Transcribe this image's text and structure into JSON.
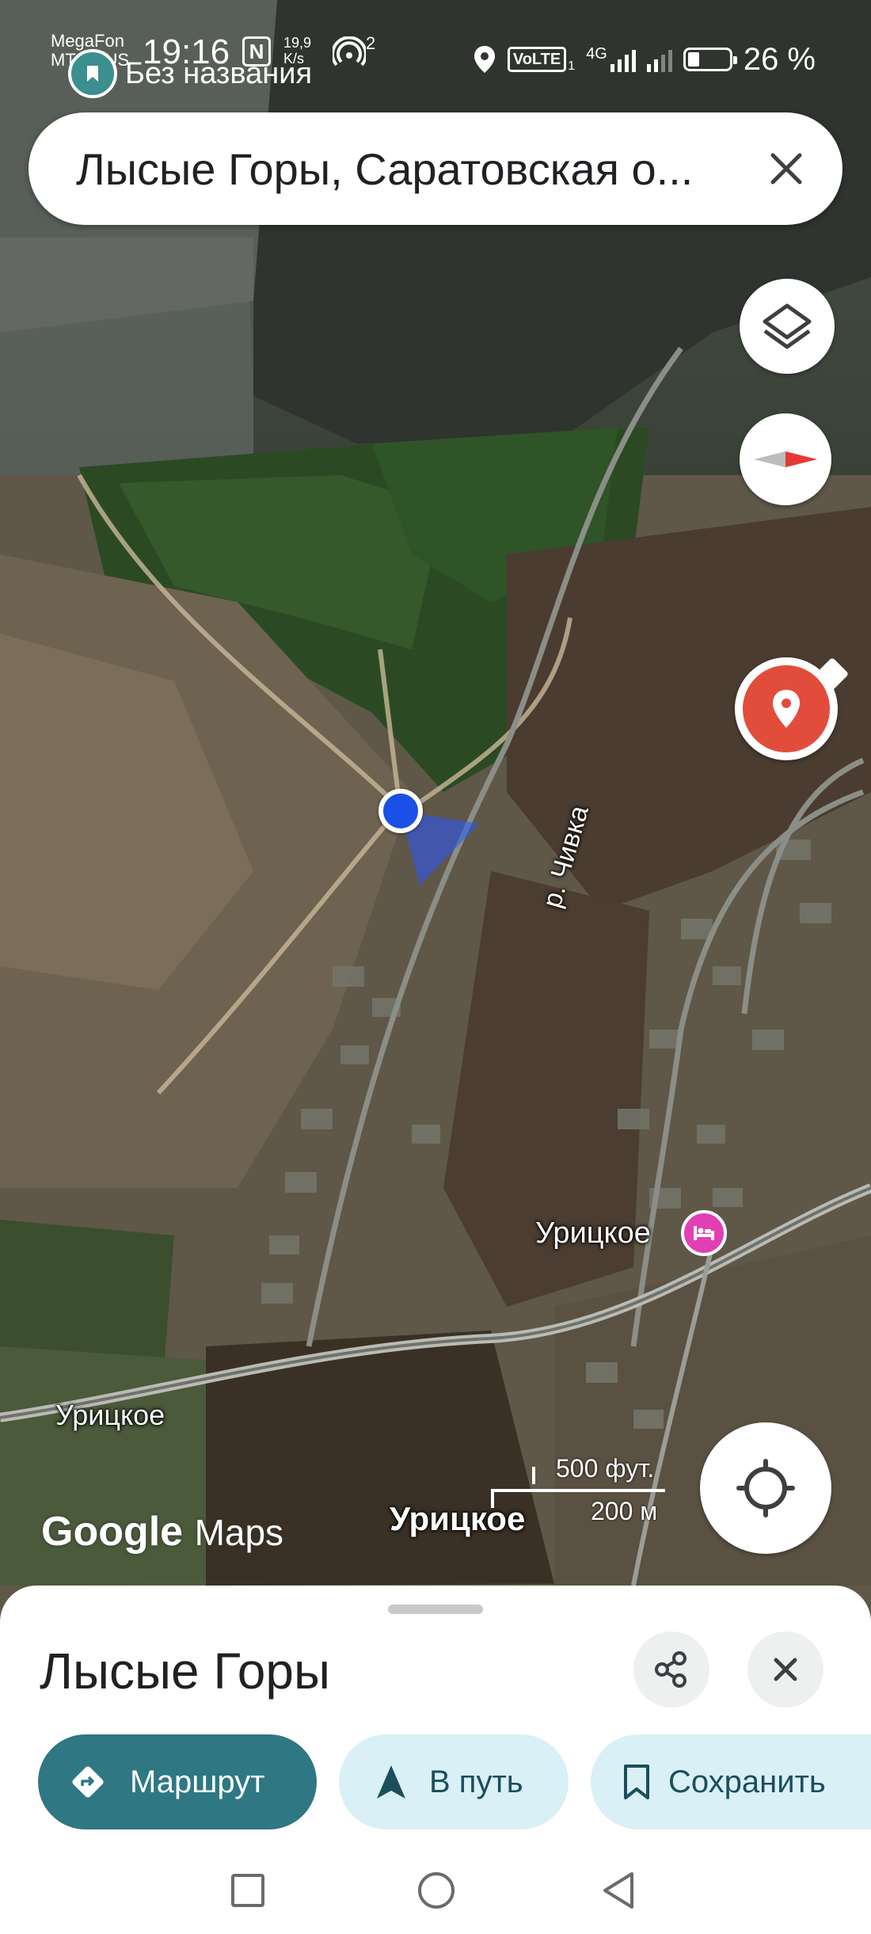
{
  "status_bar": {
    "carrier_line1": "MegaFon",
    "carrier_line2": "MTS RUS",
    "time": "19:16",
    "network_speed": "19,9 K/s",
    "hotspot_count": "2",
    "volte": "VoLTE",
    "volte_sub": "1",
    "network_type": "4G",
    "battery": "26 %"
  },
  "saved_list_chip": {
    "label": "Без названия"
  },
  "search": {
    "query": "Лысые Горы, Саратовская о..."
  },
  "map": {
    "labels": {
      "river": "р. Чивка",
      "village_poi": "Урицкое",
      "village_road": "Урицкое",
      "village_bottom": "Урицкое"
    },
    "attribution": {
      "google": "Google",
      "maps": "Maps"
    },
    "scale": {
      "imperial": "500 фут.",
      "metric": "200 м"
    },
    "colors": {
      "location_dot": "#1a50e6",
      "poi_hotel": "#e23fb5",
      "marker": "#e24d3b"
    }
  },
  "controls": {
    "layers_icon": "layers-icon",
    "compass_icon": "compass-icon",
    "place_marker_icon": "map-pin-icon",
    "my_location_icon": "my-location-icon"
  },
  "sheet": {
    "title": "Лысые Горы",
    "actions": [
      {
        "label": "Маршрут",
        "icon": "directions-icon"
      },
      {
        "label": "В путь",
        "icon": "navigation-icon"
      },
      {
        "label": "Сохранить",
        "icon": "bookmark-icon"
      }
    ]
  }
}
